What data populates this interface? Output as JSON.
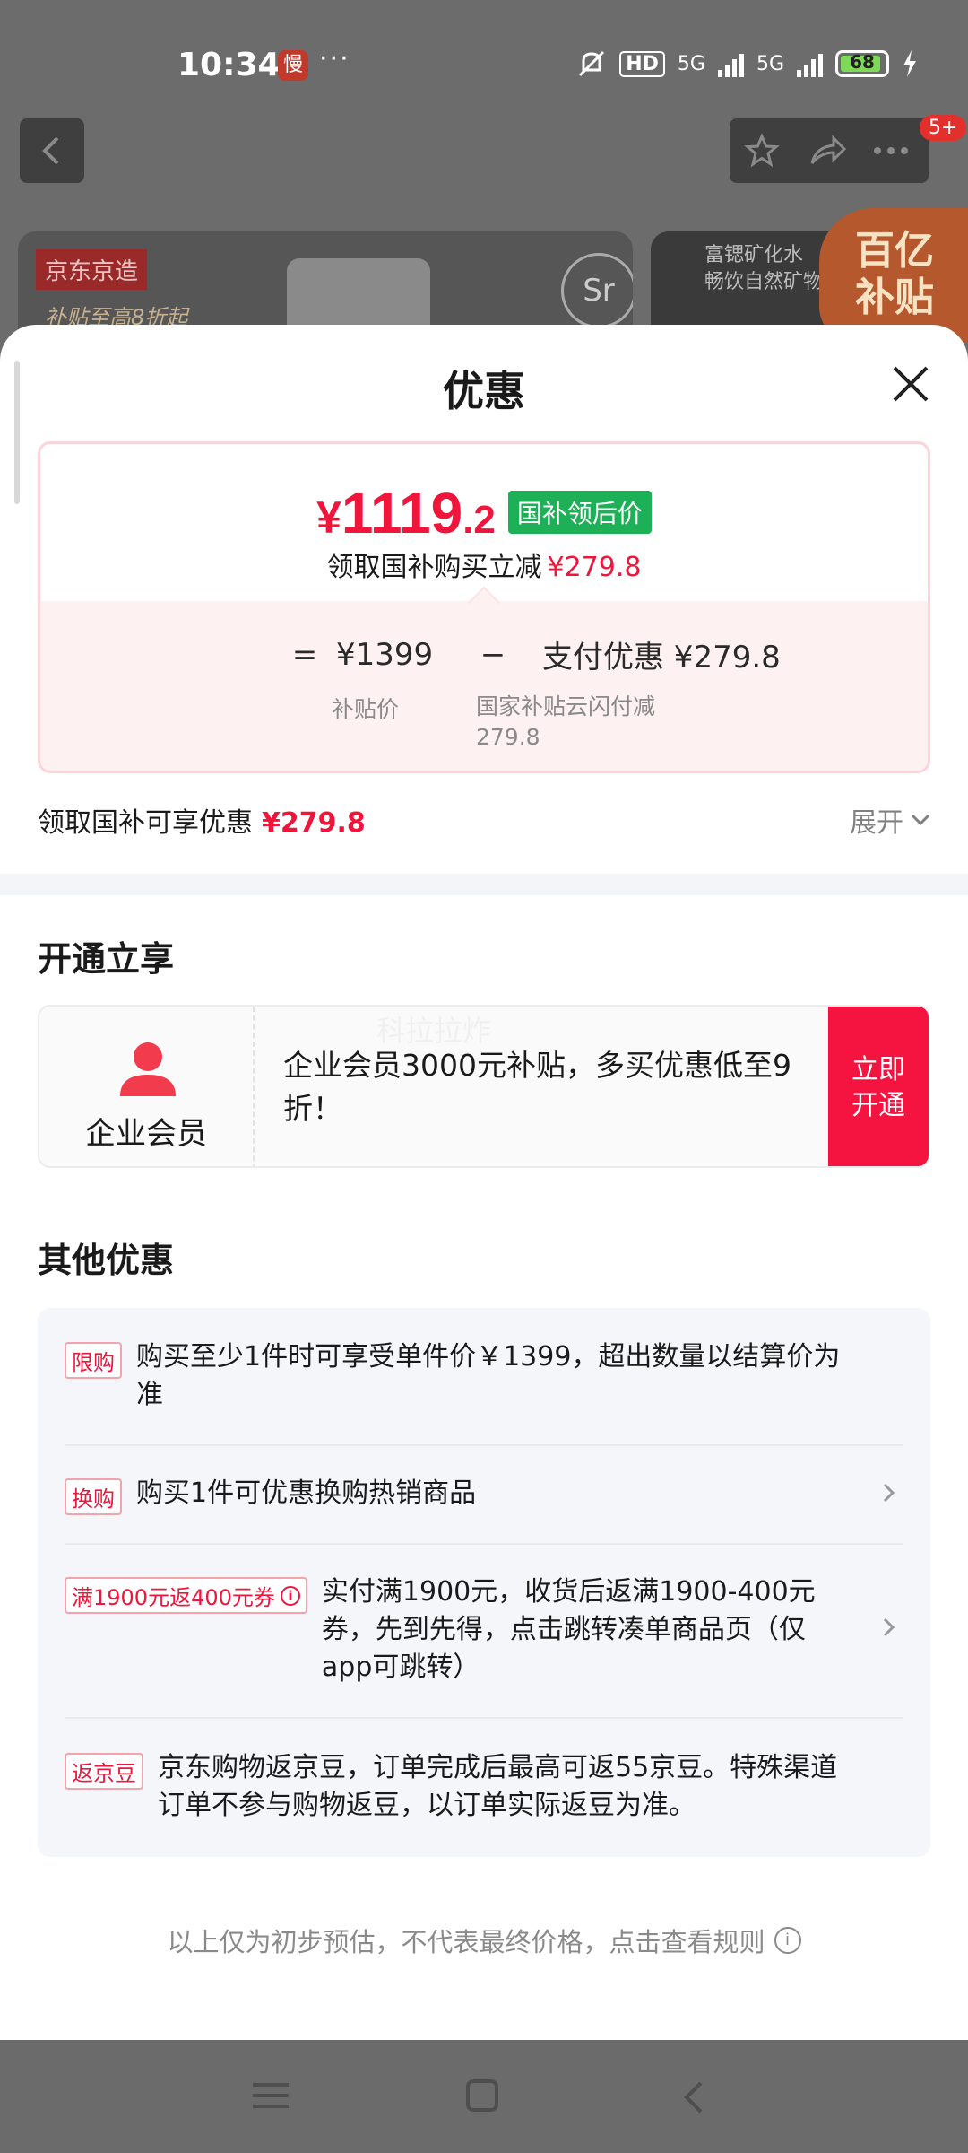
{
  "status_bar": {
    "time": "10:34",
    "app_icon_text": "慢",
    "more": "···",
    "hd": "HD",
    "net1": "5G",
    "net2": "5G",
    "battery": "68"
  },
  "background_page": {
    "badge": "5+",
    "card1_tag": "京东京造",
    "card1_sub": "补贴至高8折起",
    "card1_logo": "Sr",
    "card2_line1": "富锶矿化水",
    "card2_line2": "畅饮自然矿物",
    "promo_line1": "百亿",
    "promo_line2": "补贴"
  },
  "sheet": {
    "title": "优惠",
    "price": {
      "symbol": "¥",
      "integer": "1119",
      "decimal": ".2",
      "badge": "国补领后价",
      "reduce_label": "领取国补购买立减",
      "reduce_amount": "¥279.8",
      "equals": "=",
      "base_price": "¥1399",
      "minus": "−",
      "discount_label": "支付优惠 ¥279.8",
      "base_caption": "补贴价",
      "discount_caption_line1": "国家补贴云闪付减",
      "discount_caption_line2": "279.8"
    },
    "gov_row": {
      "label": "领取国补可享优惠",
      "amount": "¥279.8",
      "expand": "展开"
    },
    "open_section": {
      "title": "开通立享",
      "member_label": "企业会员",
      "member_desc": "企业会员3000元补贴，多买优惠低至9折！",
      "open_button": "立即开通",
      "watermark": "科拉拉炸"
    },
    "other_section": {
      "title": "其他优惠",
      "items": [
        {
          "tag": "限购",
          "text": "购买至少1件时可享受单件价￥1399，超出数量以结算价为准"
        },
        {
          "tag": "换购",
          "text": "购买1件可优惠换购热销商品"
        },
        {
          "tag": "满1900元返400元券",
          "text": "实付满1900元，收货后返满1900-400元券，先到先得，点击跳转凑单商品页（仅app可跳转）"
        },
        {
          "tag": "返京豆",
          "text": "京东购物返京豆，订单完成后最高可返55京豆。特殊渠道订单不参与购物返豆，以订单实际返豆为准。"
        }
      ]
    },
    "footer_note": "以上仅为初步预估，不代表最终价格，点击查看规则"
  },
  "colors": {
    "accent_red": "#f0153a",
    "badge_green": "#1db056",
    "button_red": "#f5133f"
  },
  "icons": [
    "back-icon",
    "star-icon",
    "share-icon",
    "more-icon",
    "close-icon",
    "chevron-down-icon",
    "person-icon",
    "info-icon",
    "chevron-right-icon",
    "nav-menu-icon",
    "nav-home-icon",
    "nav-back-icon"
  ]
}
